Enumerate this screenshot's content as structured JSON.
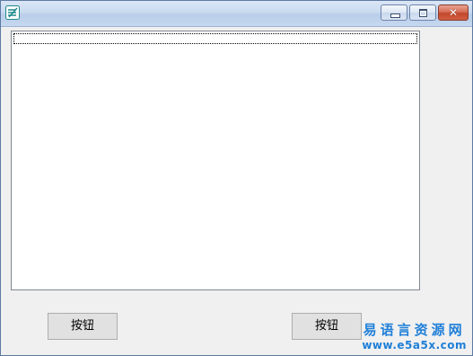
{
  "window": {
    "title": "",
    "controls": {
      "close_glyph": "✕"
    }
  },
  "listbox": {
    "items": [
      ""
    ]
  },
  "buttons": {
    "left_label": "按钮",
    "right_label": "按钮"
  },
  "watermark": {
    "text": "易语言资源网",
    "url": "www.e5a5x.com"
  },
  "icons": {
    "app": "app-logo-icon",
    "minimize": "minimize-icon",
    "maximize": "maximize-icon",
    "close": "close-icon"
  }
}
